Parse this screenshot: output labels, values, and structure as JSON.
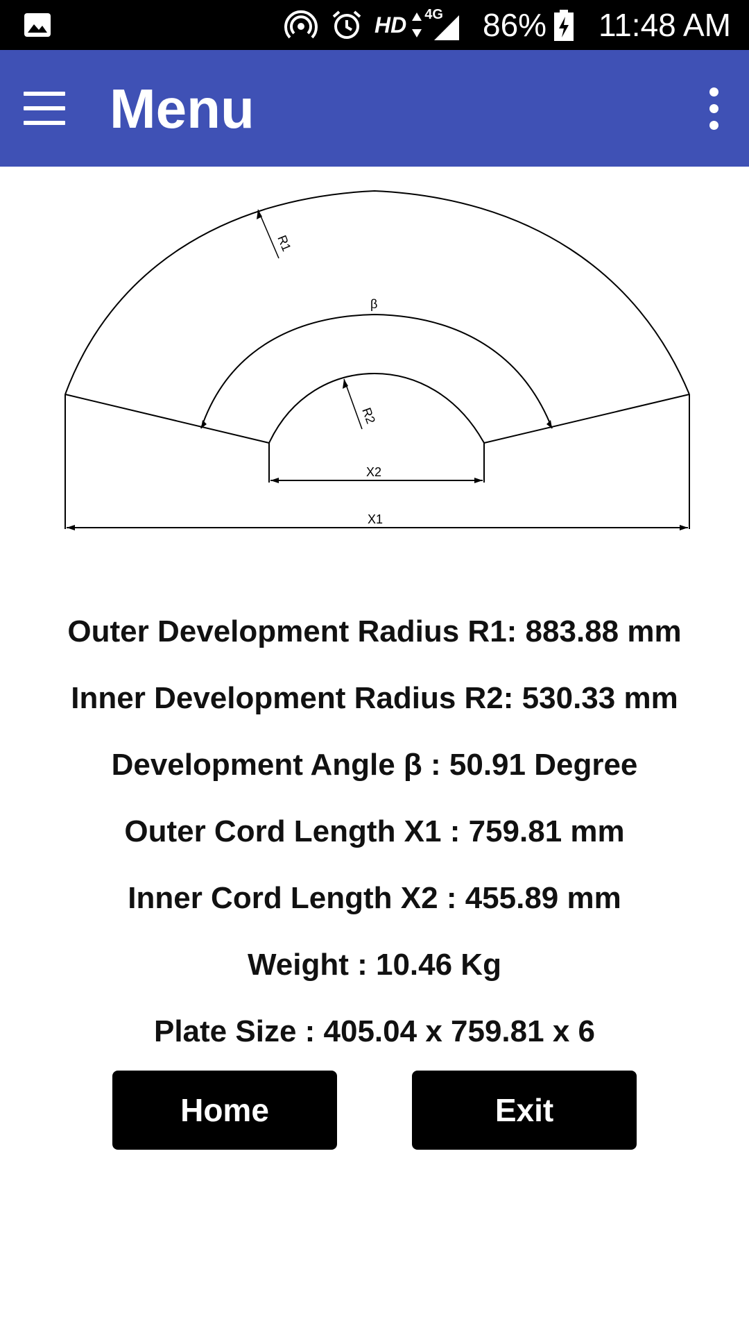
{
  "status_bar": {
    "battery_percent": "86%",
    "time": "11:48 AM",
    "network_label": "HD",
    "network_type": "4G",
    "icons": [
      "image-icon",
      "hotspot-icon",
      "alarm-icon",
      "signal-icon",
      "battery-charging-icon"
    ]
  },
  "app_bar": {
    "title": "Menu",
    "color": "#3f51b5",
    "icons": [
      "hamburger-menu-icon",
      "more-vert-icon"
    ]
  },
  "diagram": {
    "labels": {
      "r1": "R1",
      "r2": "R2",
      "beta": "β",
      "x1": "X1",
      "x2": "X2"
    }
  },
  "results": [
    "Outer Development Radius R1: 883.88 mm",
    "Inner Development Radius R2: 530.33 mm",
    "Development Angle β : 50.91 Degree",
    "Outer Cord Length X1 : 759.81 mm",
    "Inner Cord Length X2 : 455.89 mm",
    "Weight : 10.46 Kg",
    "Plate Size : 405.04 x 759.81 x 6"
  ],
  "buttons": {
    "home": "Home",
    "exit": "Exit"
  }
}
